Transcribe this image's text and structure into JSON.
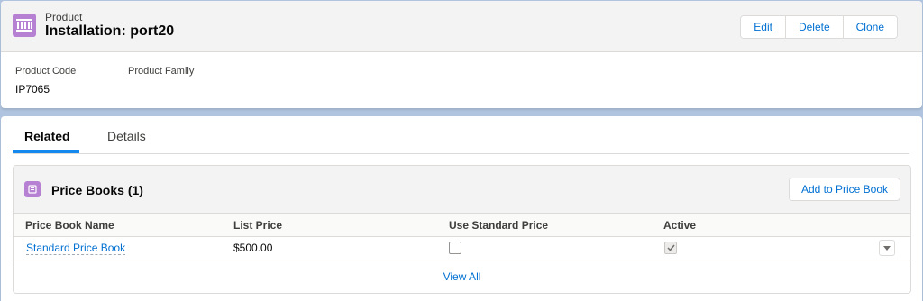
{
  "record": {
    "object_type": "Product",
    "title": "Installation: port20",
    "actions": [
      "Edit",
      "Delete",
      "Clone"
    ],
    "fields": [
      {
        "label": "Product Code",
        "value": "IP7065"
      },
      {
        "label": "Product Family",
        "value": ""
      }
    ]
  },
  "tabs": [
    {
      "label": "Related",
      "active": true
    },
    {
      "label": "Details",
      "active": false
    }
  ],
  "related_list": {
    "title": "Price Books (1)",
    "add_button": "Add to Price Book",
    "columns": [
      "Price Book Name",
      "List Price",
      "Use Standard Price",
      "Active"
    ],
    "rows": [
      {
        "name": "Standard Price Book",
        "list_price": "$500.00",
        "use_standard_price": false,
        "active": true
      }
    ],
    "view_all": "View All"
  },
  "colors": {
    "accent": "#0070d2",
    "object_icon": "#b781d3",
    "tab_underline": "#1589ee",
    "page_background": "#b0c4df"
  },
  "icons": {
    "object": "product-icon",
    "related": "pricebook-icon",
    "row_menu": "chevron-down-icon",
    "checkmark": "checkmark-icon"
  }
}
